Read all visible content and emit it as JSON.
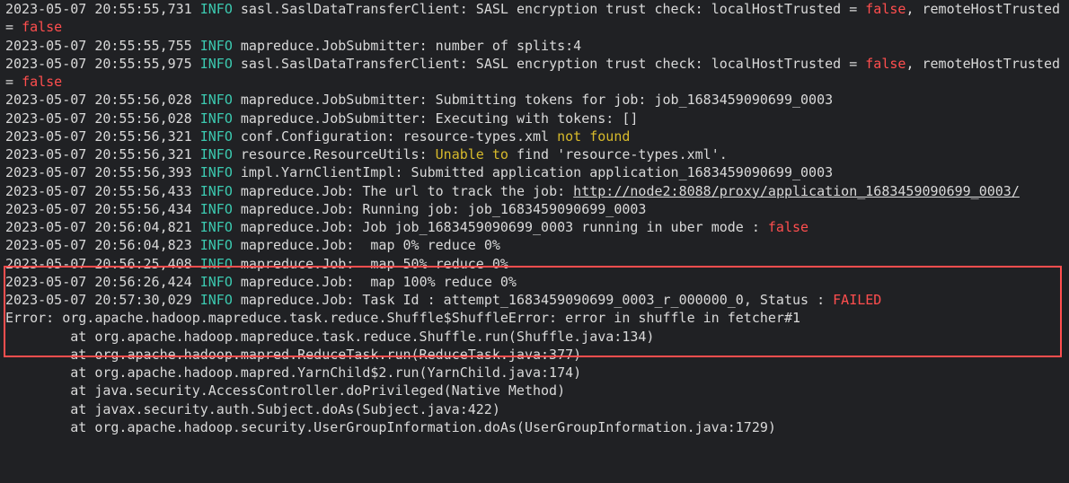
{
  "lines": [
    {
      "ts": "2023-05-07 20:55:55,731",
      "lvl": "INFO",
      "msg_parts": [
        {
          "t": "w",
          "v": " sasl.SaslDataTransferClient: SASL encryption trust check: localHostTrusted = "
        },
        {
          "t": "r",
          "v": "false"
        },
        {
          "t": "w",
          "v": ", remoteHostTrusted = "
        },
        {
          "t": "r",
          "v": "false"
        }
      ]
    },
    {
      "ts": "2023-05-07 20:55:55,755",
      "lvl": "INFO",
      "msg_parts": [
        {
          "t": "w",
          "v": " mapreduce.JobSubmitter: number of splits:4"
        }
      ]
    },
    {
      "ts": "2023-05-07 20:55:55,975",
      "lvl": "INFO",
      "msg_parts": [
        {
          "t": "w",
          "v": " sasl.SaslDataTransferClient: SASL encryption trust check: localHostTrusted = "
        },
        {
          "t": "r",
          "v": "false"
        },
        {
          "t": "w",
          "v": ", remoteHostTrusted = "
        },
        {
          "t": "r",
          "v": "false"
        }
      ]
    },
    {
      "ts": "2023-05-07 20:55:56,028",
      "lvl": "INFO",
      "msg_parts": [
        {
          "t": "w",
          "v": " mapreduce.JobSubmitter: Submitting tokens for job: job_1683459090699_0003"
        }
      ]
    },
    {
      "ts": "2023-05-07 20:55:56,028",
      "lvl": "INFO",
      "msg_parts": [
        {
          "t": "w",
          "v": " mapreduce.JobSubmitter: Executing with tokens: []"
        }
      ]
    },
    {
      "ts": "2023-05-07 20:55:56,321",
      "lvl": "INFO",
      "msg_parts": [
        {
          "t": "w",
          "v": " conf.Configuration: resource-types.xml "
        },
        {
          "t": "y",
          "v": "not found"
        }
      ]
    },
    {
      "ts": "2023-05-07 20:55:56,321",
      "lvl": "INFO",
      "msg_parts": [
        {
          "t": "w",
          "v": " resource.ResourceUtils: "
        },
        {
          "t": "y",
          "v": "Unable to"
        },
        {
          "t": "w",
          "v": " find 'resource-types.xml'."
        }
      ]
    },
    {
      "ts": "2023-05-07 20:55:56,393",
      "lvl": "INFO",
      "msg_parts": [
        {
          "t": "w",
          "v": " impl.YarnClientImpl: Submitted application application_1683459090699_0003"
        }
      ]
    },
    {
      "ts": "2023-05-07 20:55:56,433",
      "lvl": "INFO",
      "msg_parts": [
        {
          "t": "w",
          "v": " mapreduce.Job: The url to track the job: "
        },
        {
          "t": "u",
          "v": "http://node2:8088/proxy/application_1683459090699_0003/"
        }
      ]
    },
    {
      "ts": "2023-05-07 20:55:56,434",
      "lvl": "INFO",
      "msg_parts": [
        {
          "t": "w",
          "v": " mapreduce.Job: Running job: job_1683459090699_0003"
        }
      ]
    },
    {
      "ts": "2023-05-07 20:56:04,821",
      "lvl": "INFO",
      "msg_parts": [
        {
          "t": "w",
          "v": " mapreduce.Job: Job job_1683459090699_0003 running in uber mode : "
        },
        {
          "t": "r",
          "v": "false"
        }
      ]
    },
    {
      "ts": "2023-05-07 20:56:04,823",
      "lvl": "INFO",
      "msg_parts": [
        {
          "t": "w",
          "v": " mapreduce.Job:  map 0% reduce 0%"
        }
      ]
    },
    {
      "ts": "2023-05-07 20:56:25,408",
      "lvl": "INFO",
      "msg_parts": [
        {
          "t": "w",
          "v": " mapreduce.Job:  map 50% reduce 0%"
        }
      ]
    },
    {
      "ts": "2023-05-07 20:56:26,424",
      "lvl": "INFO",
      "msg_parts": [
        {
          "t": "w",
          "v": " mapreduce.Job:  map 100% reduce 0%"
        }
      ]
    },
    {
      "ts": "2023-05-07 20:57:30,029",
      "lvl": "INFO",
      "msg_parts": [
        {
          "t": "w",
          "v": " mapreduce.Job: Task Id : attempt_1683459090699_0003_r_000000_0, Status : "
        },
        {
          "t": "r",
          "v": "FAILED"
        }
      ]
    }
  ],
  "error_line": "Error: org.apache.hadoop.mapreduce.task.reduce.Shuffle$ShuffleError: error in shuffle in fetcher#1",
  "stack": [
    "at org.apache.hadoop.mapreduce.task.reduce.Shuffle.run(Shuffle.java:134)",
    "at org.apache.hadoop.mapred.ReduceTask.run(ReduceTask.java:377)",
    "at org.apache.hadoop.mapred.YarnChild$2.run(YarnChild.java:174)",
    "at java.security.AccessController.doPrivileged(Native Method)",
    "at javax.security.auth.Subject.doAs(Subject.java:422)",
    "at org.apache.hadoop.security.UserGroupInformation.doAs(UserGroupInformation.java:1729)"
  ]
}
